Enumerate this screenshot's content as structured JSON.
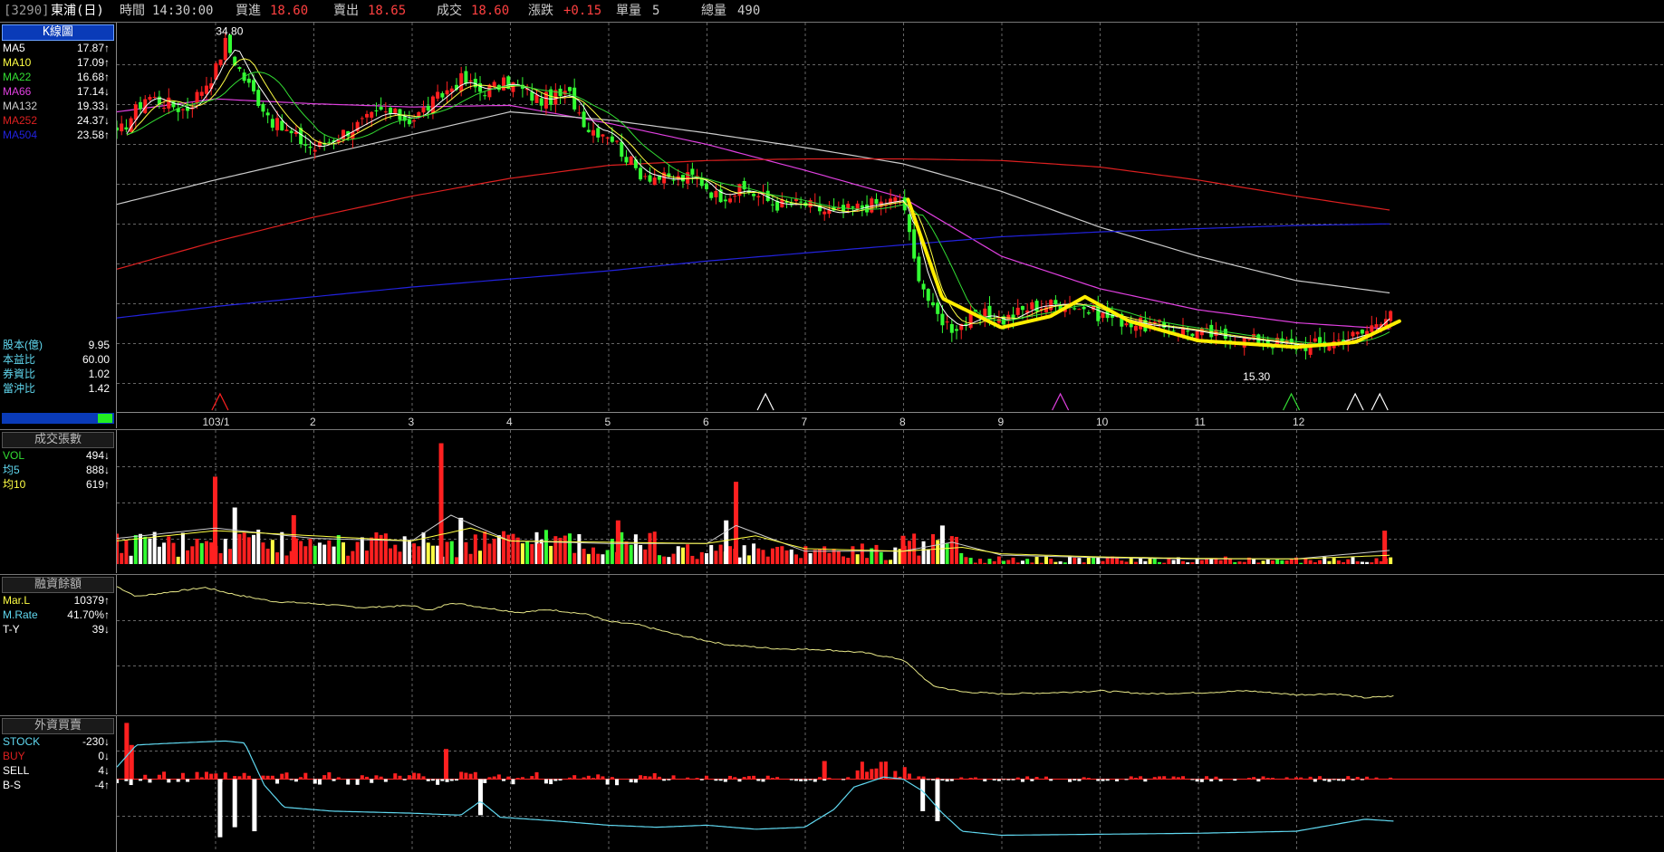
{
  "header": {
    "code": "[3290]",
    "name": "東浦(日)",
    "time_label": "時間",
    "time_value": "14:30:00",
    "bid_label": "買進",
    "bid_value": "18.60",
    "ask_label": "賣出",
    "ask_value": "18.65",
    "deal_label": "成交",
    "deal_value": "18.60",
    "change_label": "漲跌",
    "change_value": "+0.15",
    "unit_label": "單量",
    "unit_value": "5",
    "total_label": "總量",
    "total_value": "490"
  },
  "colors": {
    "up": "#ff2020",
    "down": "#33ff33",
    "ma5": "#ffffff",
    "ma10": "#ffff44",
    "ma22": "#33dd33",
    "ma66": "#e040e0",
    "ma132": "#cccccc",
    "ma252": "#dd2020",
    "ma504": "#2222dd",
    "grid": "#666666",
    "highlight": "#ffee00",
    "cyan": "#60d8f0"
  },
  "kline": {
    "title": "K線圖",
    "ma_rows": [
      {
        "label": "MA5",
        "value": "17.87",
        "arrow": "↑",
        "color": "#ffffff"
      },
      {
        "label": "MA10",
        "value": "17.09",
        "arrow": "↑",
        "color": "#ffff44"
      },
      {
        "label": "MA22",
        "value": "16.68",
        "arrow": "↑",
        "color": "#33dd33"
      },
      {
        "label": "MA66",
        "value": "17.14",
        "arrow": "↓",
        "color": "#e040e0"
      },
      {
        "label": "MA132",
        "value": "19.33",
        "arrow": "↓",
        "color": "#cccccc"
      },
      {
        "label": "MA252",
        "value": "24.37",
        "arrow": "↓",
        "color": "#dd2020"
      },
      {
        "label": "MA504",
        "value": "23.58",
        "arrow": "↑",
        "color": "#2222dd"
      }
    ],
    "fund_rows": [
      {
        "label": "股本(億)",
        "value": "9.95"
      },
      {
        "label": "本益比",
        "value": "60.00"
      },
      {
        "label": "券資比",
        "value": "1.02"
      },
      {
        "label": "當沖比",
        "value": "1.42"
      }
    ],
    "annot_high": "34.80",
    "annot_low": "15.30",
    "x_labels": [
      "103/1",
      "2",
      "3",
      "4",
      "5",
      "6",
      "7",
      "8",
      "9",
      "10",
      "11",
      "12"
    ]
  },
  "volume": {
    "title": "成交張數",
    "rows": [
      {
        "label": "VOL",
        "value": "494",
        "arrow": "↓",
        "color": "#33dd33"
      },
      {
        "label": "均5",
        "value": "888",
        "arrow": "↓",
        "color": "#60d8f0"
      },
      {
        "label": "均10",
        "value": "619",
        "arrow": "↑",
        "color": "#ffff44"
      }
    ]
  },
  "margin": {
    "title": "融資餘額",
    "rows": [
      {
        "label": "Mar.L",
        "value": "10379",
        "arrow": "↑",
        "color": "#ffff44"
      },
      {
        "label": "M.Rate",
        "value": "41.70%",
        "arrow": "↑",
        "color": "#60d8f0"
      },
      {
        "label": "T-Y",
        "value": "39",
        "arrow": "↓",
        "color": "#ffffff"
      }
    ]
  },
  "foreign": {
    "title": "外資買賣",
    "rows": [
      {
        "label": "STOCK",
        "value": "-230",
        "arrow": "↓",
        "color": "#60d8f0"
      },
      {
        "label": "BUY",
        "value": "0",
        "arrow": "↓",
        "color": "#dd2020"
      },
      {
        "label": "SELL",
        "value": "4",
        "arrow": "↓",
        "color": "#ffffff"
      },
      {
        "label": "B-S",
        "value": "-4",
        "arrow": "↑",
        "color": "#ffffff"
      }
    ]
  },
  "chart_data": [
    {
      "type": "candlestick",
      "title": "K線圖",
      "x": [
        "103/1",
        "2",
        "3",
        "4",
        "5",
        "6",
        "7",
        "8",
        "9",
        "10",
        "11",
        "12"
      ],
      "ylim": [
        12,
        36
      ],
      "grid": true,
      "close_path": [
        [
          0,
          29.0
        ],
        [
          0.3,
          31.5
        ],
        [
          0.7,
          30.6
        ],
        [
          1.0,
          33.0
        ],
        [
          1.1,
          34.8
        ],
        [
          1.3,
          32.5
        ],
        [
          1.6,
          29.8
        ],
        [
          1.8,
          29.0
        ],
        [
          2.0,
          28.2
        ],
        [
          2.3,
          29.2
        ],
        [
          2.7,
          30.5
        ],
        [
          3.0,
          30.0
        ],
        [
          3.3,
          31.5
        ],
        [
          3.5,
          32.5
        ],
        [
          3.7,
          31.8
        ],
        [
          4.0,
          32.3
        ],
        [
          4.3,
          31.2
        ],
        [
          4.6,
          31.6
        ],
        [
          4.8,
          29.5
        ],
        [
          5.0,
          29.2
        ],
        [
          5.3,
          26.8
        ],
        [
          5.6,
          26.3
        ],
        [
          5.9,
          26.5
        ],
        [
          6.1,
          25.3
        ],
        [
          6.4,
          25.7
        ],
        [
          6.7,
          24.8
        ],
        [
          7.0,
          24.8
        ],
        [
          7.3,
          24.2
        ],
        [
          7.6,
          24.7
        ],
        [
          8.0,
          25.1
        ],
        [
          8.1,
          21.5
        ],
        [
          8.3,
          18.2
        ],
        [
          8.5,
          17.2
        ],
        [
          8.8,
          18.0
        ],
        [
          9.0,
          17.6
        ],
        [
          9.3,
          18.5
        ],
        [
          9.7,
          18.7
        ],
        [
          10.0,
          18.0
        ],
        [
          10.4,
          17.4
        ],
        [
          10.8,
          17.1
        ],
        [
          11.2,
          16.7
        ],
        [
          11.6,
          16.4
        ],
        [
          12.0,
          16.1
        ],
        [
          12.3,
          16.2
        ],
        [
          12.7,
          16.9
        ],
        [
          13.0,
          18.6
        ]
      ],
      "ma_paths": {
        "MA66": [
          [
            0,
            30.5
          ],
          [
            1,
            31.3
          ],
          [
            2,
            31.0
          ],
          [
            3,
            30.8
          ],
          [
            4,
            30.9
          ],
          [
            5,
            29.8
          ],
          [
            6,
            28.5
          ],
          [
            7,
            26.9
          ],
          [
            8,
            25.2
          ],
          [
            9,
            21.6
          ],
          [
            10,
            19.6
          ],
          [
            11,
            18.3
          ],
          [
            12,
            17.5
          ],
          [
            13,
            17.1
          ]
        ],
        "MA132": [
          [
            0,
            24.8
          ],
          [
            1,
            26.3
          ],
          [
            2,
            27.7
          ],
          [
            3,
            29.1
          ],
          [
            4,
            30.5
          ],
          [
            5,
            30.0
          ],
          [
            6,
            29.2
          ],
          [
            7,
            28.3
          ],
          [
            8,
            27.3
          ],
          [
            9,
            25.6
          ],
          [
            10,
            23.4
          ],
          [
            11,
            21.6
          ],
          [
            12,
            20.1
          ],
          [
            13,
            19.3
          ]
        ],
        "MA252": [
          [
            0,
            20.8
          ],
          [
            1,
            22.5
          ],
          [
            2,
            24.0
          ],
          [
            3,
            25.3
          ],
          [
            4,
            26.4
          ],
          [
            5,
            27.2
          ],
          [
            6,
            27.5
          ],
          [
            7,
            27.6
          ],
          [
            8,
            27.6
          ],
          [
            9,
            27.5
          ],
          [
            10,
            27.1
          ],
          [
            11,
            26.3
          ],
          [
            12,
            25.3
          ],
          [
            13,
            24.4
          ]
        ],
        "MA504": [
          [
            0,
            17.8
          ],
          [
            1,
            18.5
          ],
          [
            2,
            19.1
          ],
          [
            3,
            19.7
          ],
          [
            4,
            20.2
          ],
          [
            5,
            20.7
          ],
          [
            6,
            21.3
          ],
          [
            7,
            21.8
          ],
          [
            8,
            22.3
          ],
          [
            9,
            22.8
          ],
          [
            10,
            23.1
          ],
          [
            11,
            23.3
          ],
          [
            12,
            23.5
          ],
          [
            13,
            23.6
          ]
        ]
      },
      "highlight_curve": [
        [
          8.05,
          25.1
        ],
        [
          8.4,
          19.0
        ],
        [
          9.0,
          17.2
        ],
        [
          9.5,
          17.9
        ],
        [
          9.85,
          19.1
        ],
        [
          10.3,
          17.6
        ],
        [
          11.0,
          16.4
        ],
        [
          12.0,
          16.0
        ],
        [
          12.6,
          16.3
        ],
        [
          13.05,
          17.6
        ]
      ],
      "annotations": [
        {
          "text": "34.80",
          "x": 1.1,
          "y": 34.8
        },
        {
          "text": "15.30",
          "x": 11.55,
          "y": 15.3
        }
      ]
    },
    {
      "type": "bar",
      "title": "成交張數",
      "x": [
        "103/1",
        "2",
        "3",
        "4",
        "5",
        "6",
        "7",
        "8",
        "9",
        "10",
        "11",
        "12"
      ],
      "ylim": [
        0,
        5000
      ],
      "grid": true,
      "spikes": [
        [
          1.0,
          3400
        ],
        [
          1.2,
          2200
        ],
        [
          1.8,
          1900
        ],
        [
          3.3,
          4700
        ],
        [
          3.5,
          1800
        ],
        [
          4.3,
          800
        ],
        [
          5.1,
          1700
        ],
        [
          6.2,
          1700
        ],
        [
          6.3,
          3200
        ],
        [
          8.0,
          1100
        ],
        [
          8.4,
          1500
        ],
        [
          12.9,
          1300
        ]
      ],
      "series": [
        {
          "name": "均5",
          "values": [
            [
              0,
              1000
            ],
            [
              1,
              1400
            ],
            [
              2,
              1000
            ],
            [
              3,
              900
            ],
            [
              3.4,
              1900
            ],
            [
              4,
              900
            ],
            [
              5,
              800
            ],
            [
              6,
              800
            ],
            [
              6.3,
              1500
            ],
            [
              7,
              500
            ],
            [
              8,
              500
            ],
            [
              8.5,
              850
            ],
            [
              9,
              350
            ],
            [
              10,
              250
            ],
            [
              11,
              200
            ],
            [
              12,
              200
            ],
            [
              13,
              550
            ]
          ]
        },
        {
          "name": "均10",
          "values": [
            [
              0,
              900
            ],
            [
              1,
              1300
            ],
            [
              2,
              1100
            ],
            [
              3,
              900
            ],
            [
              3.6,
              1400
            ],
            [
              4,
              900
            ],
            [
              5,
              850
            ],
            [
              6,
              800
            ],
            [
              6.5,
              1100
            ],
            [
              7,
              600
            ],
            [
              8,
              500
            ],
            [
              8.6,
              650
            ],
            [
              9,
              400
            ],
            [
              10,
              280
            ],
            [
              11,
              220
            ],
            [
              12,
              200
            ],
            [
              13,
              350
            ]
          ]
        }
      ]
    },
    {
      "type": "line",
      "title": "融資餘額",
      "x": [
        "103/1",
        "2",
        "3",
        "4",
        "5",
        "6",
        "7",
        "8",
        "9",
        "10",
        "11",
        "12"
      ],
      "ylim": [
        9000,
        22000
      ],
      "grid": true,
      "series": [
        {
          "name": "Mar.L",
          "values": [
            [
              0,
              21300
            ],
            [
              0.2,
              20300
            ],
            [
              0.5,
              20700
            ],
            [
              0.9,
              21200
            ],
            [
              1.2,
              20500
            ],
            [
              1.6,
              19800
            ],
            [
              2.0,
              19600
            ],
            [
              2.5,
              19200
            ],
            [
              3.0,
              19400
            ],
            [
              3.2,
              18900
            ],
            [
              3.4,
              19700
            ],
            [
              3.8,
              19100
            ],
            [
              4.1,
              18700
            ],
            [
              4.4,
              19000
            ],
            [
              4.8,
              18500
            ],
            [
              5.0,
              17800
            ],
            [
              5.3,
              17500
            ],
            [
              5.7,
              16500
            ],
            [
              6.2,
              15500
            ],
            [
              6.7,
              15100
            ],
            [
              7.2,
              15000
            ],
            [
              7.6,
              14700
            ],
            [
              8.0,
              14000
            ],
            [
              8.3,
              11400
            ],
            [
              8.6,
              10800
            ],
            [
              9.0,
              10600
            ],
            [
              9.5,
              10700
            ],
            [
              10.0,
              10900
            ],
            [
              10.5,
              10600
            ],
            [
              11.0,
              10700
            ],
            [
              11.5,
              10900
            ],
            [
              12.0,
              10500
            ],
            [
              12.4,
              10600
            ],
            [
              12.7,
              10200
            ],
            [
              13.0,
              10379
            ]
          ]
        }
      ]
    },
    {
      "type": "bar",
      "title": "外資買賣",
      "x": [
        "103/1",
        "2",
        "3",
        "4",
        "5",
        "6",
        "7",
        "8",
        "9",
        "10",
        "11",
        "12"
      ],
      "ylim": [
        -3500,
        3000
      ],
      "grid": true,
      "spikes": [
        [
          0.1,
          2800
        ],
        [
          0.15,
          1700
        ],
        [
          1.05,
          -2900
        ],
        [
          1.2,
          -2400
        ],
        [
          1.4,
          -2600
        ],
        [
          3.35,
          1500
        ],
        [
          3.7,
          -1800
        ],
        [
          8.2,
          -1600
        ],
        [
          8.35,
          -2100
        ],
        [
          7.2,
          900
        ]
      ],
      "series": [
        {
          "name": "STOCK",
          "values": [
            [
              0,
              600
            ],
            [
              0.2,
              1700
            ],
            [
              0.6,
              1800
            ],
            [
              1.1,
              1900
            ],
            [
              1.3,
              1800
            ],
            [
              1.5,
              -300
            ],
            [
              1.7,
              -1400
            ],
            [
              2.2,
              -1600
            ],
            [
              3.0,
              -1700
            ],
            [
              3.5,
              -1800
            ],
            [
              3.7,
              -1100
            ],
            [
              3.9,
              -1900
            ],
            [
              4.5,
              -2100
            ],
            [
              5.0,
              -2300
            ],
            [
              5.5,
              -2400
            ],
            [
              6.0,
              -2300
            ],
            [
              6.5,
              -2500
            ],
            [
              7.0,
              -2400
            ],
            [
              7.3,
              -1500
            ],
            [
              7.5,
              -400
            ],
            [
              7.8,
              100
            ],
            [
              8.0,
              0
            ],
            [
              8.2,
              -600
            ],
            [
              8.4,
              -1700
            ],
            [
              8.6,
              -2600
            ],
            [
              9.0,
              -2800
            ],
            [
              10.0,
              -2750
            ],
            [
              11.0,
              -2700
            ],
            [
              12.0,
              -2600
            ],
            [
              12.7,
              -2000
            ],
            [
              13.0,
              -2100
            ]
          ]
        }
      ]
    }
  ]
}
